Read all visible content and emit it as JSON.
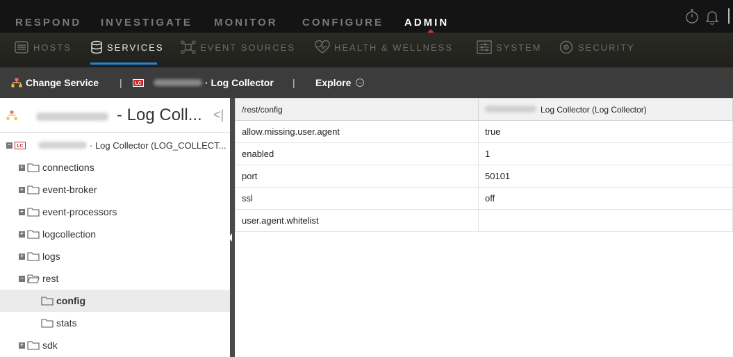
{
  "top_nav": {
    "items": [
      {
        "label": "RESPOND",
        "active": false
      },
      {
        "label": "INVESTIGATE",
        "active": false
      },
      {
        "label": "MONITOR",
        "active": false
      },
      {
        "label": "CONFIGURE",
        "active": false
      },
      {
        "label": "ADMIN",
        "active": true
      }
    ],
    "icons": [
      "timer-icon",
      "notification-bell-icon"
    ]
  },
  "sub_nav": {
    "items": [
      {
        "label": "HOSTS",
        "icon": "hosts-icon",
        "active": false
      },
      {
        "label": "SERVICES",
        "icon": "database-icon",
        "active": true
      },
      {
        "label": "EVENT SOURCES",
        "icon": "event-sources-icon",
        "active": false
      },
      {
        "label": "HEALTH & WELLNESS",
        "icon": "health-heart-icon",
        "active": false
      },
      {
        "label": "SYSTEM",
        "icon": "system-icon",
        "active": false
      },
      {
        "label": "SECURITY",
        "icon": "security-shield-icon",
        "active": false
      }
    ]
  },
  "toolbar": {
    "change_service": "Change Service",
    "separator": "|",
    "service_badge": "LC",
    "service_name": "· Log Collector",
    "explore": "Explore"
  },
  "tree": {
    "header_title": "- Log Coll...",
    "root": {
      "badge": "LC",
      "label": "· Log Collector (LOG_COLLECT..."
    },
    "nodes": [
      {
        "label": "connections",
        "expand": "+"
      },
      {
        "label": "event-broker",
        "expand": "+"
      },
      {
        "label": "event-processors",
        "expand": "+"
      },
      {
        "label": "logcollection",
        "expand": "+"
      },
      {
        "label": "logs",
        "expand": "+"
      },
      {
        "label": "rest",
        "expand": "−"
      },
      {
        "label": "config",
        "selected": true
      },
      {
        "label": "stats"
      },
      {
        "label": "sdk",
        "expand": "+"
      }
    ]
  },
  "table": {
    "header_path": "/rest/config",
    "header_service": "Log Collector (Log Collector)",
    "rows": [
      {
        "name": "allow.missing.user.agent",
        "value": "true"
      },
      {
        "name": "enabled",
        "value": "1"
      },
      {
        "name": "port",
        "value": "50101"
      },
      {
        "name": "ssl",
        "value": "off"
      },
      {
        "name": "user.agent.whitelist",
        "value": ""
      }
    ]
  },
  "colors": {
    "top_nav_bg": "#141414",
    "sub_nav_bg": "#23231f",
    "toolbar_bg": "#3c3c3c",
    "accent_blue": "#1e88e5",
    "admin_marker_red": "#d32f2f",
    "badge_red": "#c62828"
  }
}
